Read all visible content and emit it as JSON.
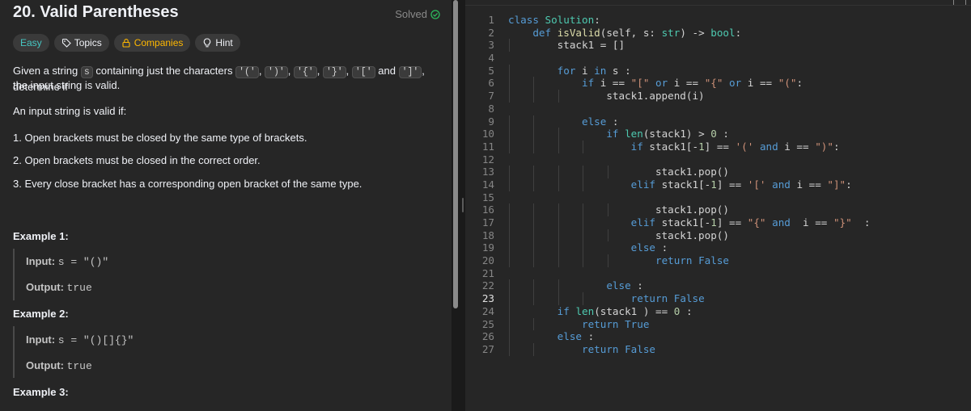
{
  "problem": {
    "title": "20. Valid Parentheses",
    "solved_label": "Solved",
    "tags": {
      "difficulty": "Easy",
      "topics": "Topics",
      "companies": "Companies",
      "hint": "Hint"
    },
    "description": {
      "p1_before": "Given a string",
      "p1_var": "s",
      "p1_mid": "containing just the characters",
      "chars": [
        "'('",
        "')'",
        "'{'",
        "'}'",
        "'['",
        "']'"
      ],
      "p1_and": "and",
      "p1_after": ", determine if",
      "p1_line2": "the input string is valid.",
      "p2": "An input string is valid if:",
      "rules": [
        "1. Open brackets must be closed by the same type of brackets.",
        "2. Open brackets must be closed in the correct order.",
        "3. Every close bracket has a corresponding open bracket of the same type."
      ]
    },
    "examples": [
      {
        "title": "Example 1:",
        "input_label": "Input:",
        "input_value": "s = \"()\"",
        "output_label": "Output:",
        "output_value": "true"
      },
      {
        "title": "Example 2:",
        "input_label": "Input:",
        "input_value": "s = \"()[]{}\"",
        "output_label": "Output:",
        "output_value": "true"
      },
      {
        "title": "Example 3:"
      }
    ]
  },
  "editor": {
    "current_line": 23,
    "lines": [
      "class Solution:",
      "    def isValid(self, s: str) -> bool:",
      "        stack1 = []",
      "",
      "        for i in s :",
      "            if i == \"[\" or i == \"{\" or i == \"(\":",
      "                stack1.append(i)",
      "",
      "            else :",
      "                if len(stack1) > 0 :",
      "                    if stack1[-1] == '(' and i == \")\":",
      "",
      "                        stack1.pop()",
      "                    elif stack1[-1] == '[' and i == \"]\":",
      "",
      "                        stack1.pop()",
      "                    elif stack1[-1] == \"{\" and  i == \"}\"  :",
      "                        stack1.pop()",
      "                    else :",
      "                        return False",
      "",
      "                else :",
      "                    return False",
      "        if len(stack1 ) == 0 :",
      "            return True",
      "        else :",
      "            return False"
    ]
  },
  "colors": {
    "easy": "#46c6c2",
    "companies": "#ffb800",
    "solved": "#2cbb5d",
    "keyword": "#569cd6",
    "function": "#dcdcaa",
    "string": "#ce9178"
  }
}
